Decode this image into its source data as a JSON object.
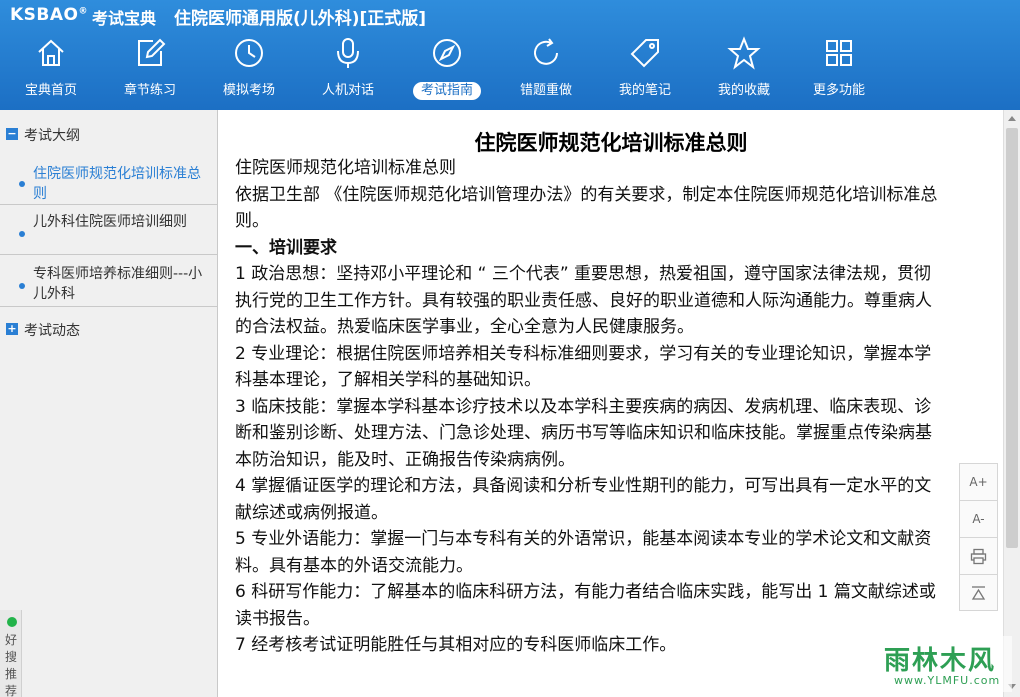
{
  "app": {
    "logo_text": "KSBAO",
    "logo_mark": "®",
    "logo_cn": "考试宝典",
    "title": "住院医师通用版(儿外科)[正式版]"
  },
  "nav": {
    "items": [
      {
        "label": "宝典首页",
        "icon": "home-icon"
      },
      {
        "label": "章节练习",
        "icon": "edit-icon"
      },
      {
        "label": "模拟考场",
        "icon": "clock-icon"
      },
      {
        "label": "人机对话",
        "icon": "microphone-icon"
      },
      {
        "label": "考试指南",
        "icon": "compass-icon",
        "active": true
      },
      {
        "label": "错题重做",
        "icon": "refresh-icon"
      },
      {
        "label": "我的笔记",
        "icon": "tag-icon"
      },
      {
        "label": "我的收藏",
        "icon": "star-icon"
      },
      {
        "label": "更多功能",
        "icon": "grid-icon"
      }
    ]
  },
  "sidebar": {
    "group1": {
      "toggle": "−",
      "label": "考试大纲"
    },
    "items": [
      {
        "label": "住院医师规范化培训标准总则",
        "active": true
      },
      {
        "label": "儿外科住院医师培训细则"
      },
      {
        "label": "专科医师培养标准细则---小儿外科"
      }
    ],
    "group2": {
      "toggle": "+",
      "label": "考试动态"
    },
    "bottom_label": "好搜推荐"
  },
  "document": {
    "title": "住院医师规范化培训标准总则",
    "paragraphs": [
      {
        "text": "住院医师规范化培训标准总则",
        "bold": false
      },
      {
        "text": "依据卫生部 《住院医师规范化培训管理办法》的有关要求，制定本住院医师规范化培训标准总则。",
        "bold": false
      },
      {
        "text": "一、培训要求",
        "bold": true
      },
      {
        "text": "1 政治思想：坚持邓小平理论和 “ 三个代表” 重要思想，热爱祖国，遵守国家法律法规，贯彻执行党的卫生工作方针。具有较强的职业责任感、良好的职业道德和人际沟通能力。尊重病人的合法权益。热爱临床医学事业，全心全意为人民健康服务。",
        "bold": false
      },
      {
        "text": "2 专业理论：根据住院医师培养相关专科标准细则要求，学习有关的专业理论知识，掌握本学科基本理论，了解相关学科的基础知识。",
        "bold": false
      },
      {
        "text": "3 临床技能：掌握本学科基本诊疗技术以及本学科主要疾病的病因、发病机理、临床表现、诊断和鉴别诊断、处理方法、门急诊处理、病历书写等临床知识和临床技能。掌握重点传染病基本防治知识，能及时、正确报告传染病病例。",
        "bold": false
      },
      {
        "text": "4 掌握循证医学的理论和方法，具备阅读和分析专业性期刊的能力，可写出具有一定水平的文献综述或病例报道。",
        "bold": false
      },
      {
        "text": "5 专业外语能力：掌握一门与本专科有关的外语常识，能基本阅读本专业的学术论文和文献资料。具有基本的外语交流能力。",
        "bold": false
      },
      {
        "text": "6 科研写作能力：了解基本的临床科研方法，有能力者结合临床实践，能写出 1 篇文献综述或读书报告。",
        "bold": false
      },
      {
        "text": "7 经考核考试证明能胜任与其相对应的专科医师临床工作。",
        "bold": false
      }
    ]
  },
  "tools": {
    "font_increase": "A+",
    "font_decrease": "A-",
    "print_icon": "print-icon",
    "top_icon": "back-to-top-icon"
  },
  "watermark": {
    "text": "雨林木风",
    "url": "www.YLMFU.com"
  },
  "colors": {
    "header_blue": "#1c6fc4",
    "accent_blue": "#2a7fd4",
    "sidebar_bg": "#f0f0f0"
  }
}
